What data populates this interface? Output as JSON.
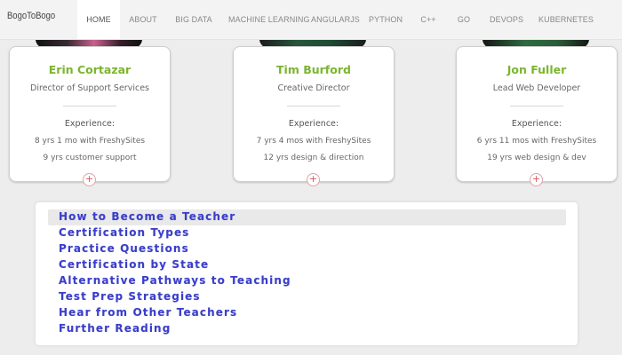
{
  "brand": "BogoToBogo",
  "nav": {
    "items": [
      {
        "label": "HOME",
        "active": true
      },
      {
        "label": "ABOUT",
        "active": false
      },
      {
        "label": "BIG DATA",
        "active": false
      },
      {
        "label": "MACHINE LEARNING",
        "active": false
      },
      {
        "label": "ANGULARJS",
        "active": false
      },
      {
        "label": "PYTHON",
        "active": false
      },
      {
        "label": "C++",
        "active": false
      },
      {
        "label": "GO",
        "active": false
      },
      {
        "label": "DEVOPS",
        "active": false
      },
      {
        "label": "KUBERNETES",
        "active": false
      }
    ]
  },
  "cards": [
    {
      "name": "Erin Cortazar",
      "title": "Director of Support Services",
      "experience_label": "Experience:",
      "line1": "8 yrs 1 mo with FreshySites",
      "line2": "9 yrs customer support",
      "expand_icon": "plus-circle-icon"
    },
    {
      "name": "Tim Burford",
      "title": "Creative Director",
      "experience_label": "Experience:",
      "line1": "7 yrs 4 mos with FreshySites",
      "line2": "12 yrs design & direction",
      "expand_icon": "plus-circle-icon"
    },
    {
      "name": "Jon Fuller",
      "title": "Lead Web Developer",
      "experience_label": "Experience:",
      "line1": "6 yrs 11 mos with FreshySites",
      "line2": "19 yrs web design & dev",
      "expand_icon": "plus-circle-icon"
    }
  ],
  "links": [
    {
      "label": "How to Become a Teacher",
      "highlighted": true
    },
    {
      "label": "Certification Types",
      "highlighted": false
    },
    {
      "label": "Practice Questions",
      "highlighted": false
    },
    {
      "label": "Certification by State",
      "highlighted": false
    },
    {
      "label": "Alternative Pathways to Teaching",
      "highlighted": false
    },
    {
      "label": "Test Prep Strategies",
      "highlighted": false
    },
    {
      "label": "Hear from Other Teachers",
      "highlighted": false
    },
    {
      "label": "Further Reading",
      "highlighted": false
    }
  ],
  "colors": {
    "name_green": "#7bb52d",
    "link_blue": "#3a3ec8",
    "plus_red": "#d95765",
    "page_bg": "#ededed"
  }
}
